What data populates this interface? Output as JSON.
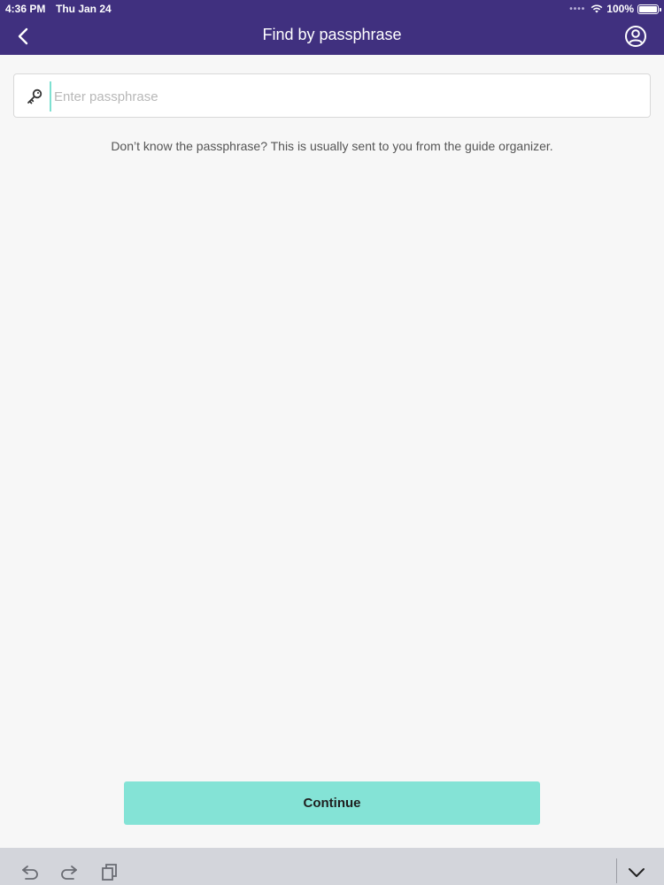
{
  "status_bar": {
    "time": "4:36 PM",
    "date": "Thu Jan 24",
    "signal": "••••",
    "battery": "100%"
  },
  "nav": {
    "title": "Find by passphrase",
    "back_icon": "chevron-left-icon",
    "profile_icon": "user-circle-icon"
  },
  "search": {
    "icon": "key-icon",
    "placeholder": "Enter passphrase",
    "value": ""
  },
  "help_text": "Don’t know the passphrase? This is usually sent to you from the guide organizer.",
  "continue_label": "Continue",
  "shortcut_bar": {
    "icons": [
      "undo-icon",
      "redo-icon",
      "paste-icon",
      "chevron-down-icon"
    ]
  },
  "colors": {
    "header": "#40307f",
    "accent": "#84e3d6",
    "background": "#f7f7f7",
    "shortcut_bar": "#d3d5db"
  }
}
